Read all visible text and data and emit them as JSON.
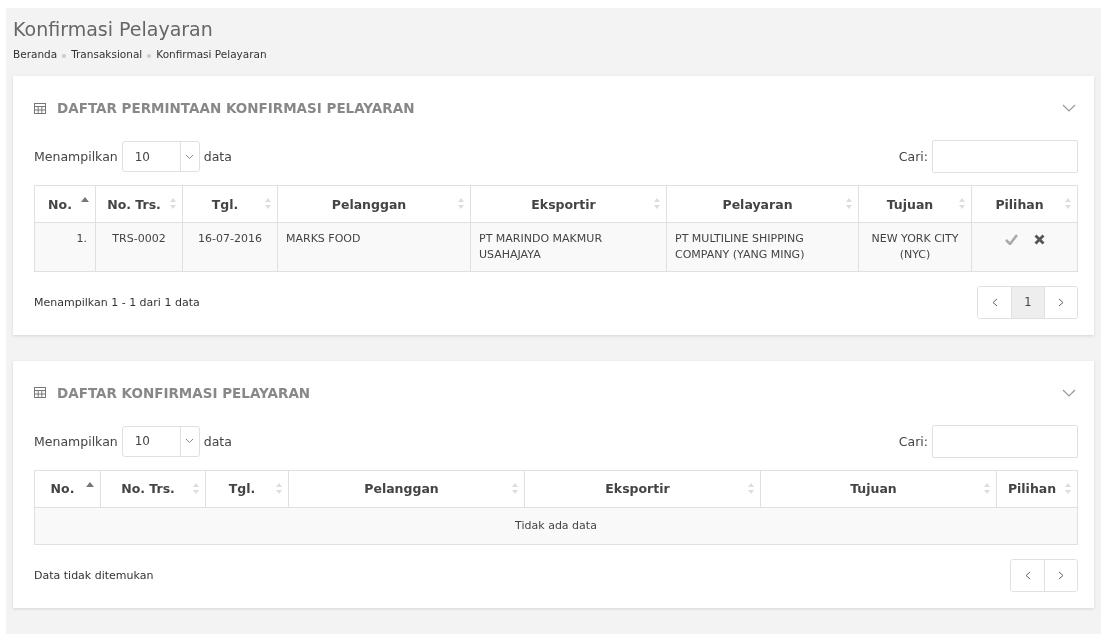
{
  "page": {
    "title": "Konfirmasi Pelayaran",
    "breadcrumb": [
      "Beranda",
      "Transaksional",
      "Konfirmasi Pelayaran"
    ]
  },
  "panels": [
    {
      "title": "DAFTAR PERMINTAAN KONFIRMASI PELAYARAN",
      "length_label": "Menampilkan",
      "length_value": "10",
      "length_suffix": "data",
      "search_label": "Cari:",
      "columns": [
        {
          "label": "No.",
          "sorted": true
        },
        {
          "label": "No. Trs.",
          "sorted": false
        },
        {
          "label": "Tgl.",
          "sorted": false
        },
        {
          "label": "Pelanggan",
          "sorted": false
        },
        {
          "label": "Eksportir",
          "sorted": false
        },
        {
          "label": "Pelayaran",
          "sorted": false
        },
        {
          "label": "Tujuan",
          "sorted": false
        },
        {
          "label": "Pilihan",
          "sorted": false
        }
      ],
      "rows": [
        {
          "cells": [
            "1.",
            "TRS-0002",
            "16-07-2016",
            "MARKS FOOD",
            "PT MARINDO MAKMUR USAHAJAYA",
            "PT MULTILINE SHIPPING COMPANY (YANG MING)",
            "NEW YORK CITY (NYC)"
          ],
          "actions": [
            {
              "kind": "approve"
            },
            {
              "kind": "reject"
            }
          ]
        }
      ],
      "info": "Menampilkan 1 - 1 dari 1 data",
      "pages": [
        {
          "label": "1",
          "selected": true
        }
      ]
    },
    {
      "title": "DAFTAR KONFIRMASI PELAYARAN",
      "length_label": "Menampilkan",
      "length_value": "10",
      "length_suffix": "data",
      "search_label": "Cari:",
      "columns": [
        {
          "label": "No.",
          "sorted": true
        },
        {
          "label": "No. Trs.",
          "sorted": false
        },
        {
          "label": "Tgl.",
          "sorted": false
        },
        {
          "label": "Pelanggan",
          "sorted": false
        },
        {
          "label": "Eksportir",
          "sorted": false
        },
        {
          "label": "Tujuan",
          "sorted": false
        },
        {
          "label": "Pilihan",
          "sorted": false
        }
      ],
      "empty_text": "Tidak ada data",
      "info": "Data tidak ditemukan"
    }
  ]
}
